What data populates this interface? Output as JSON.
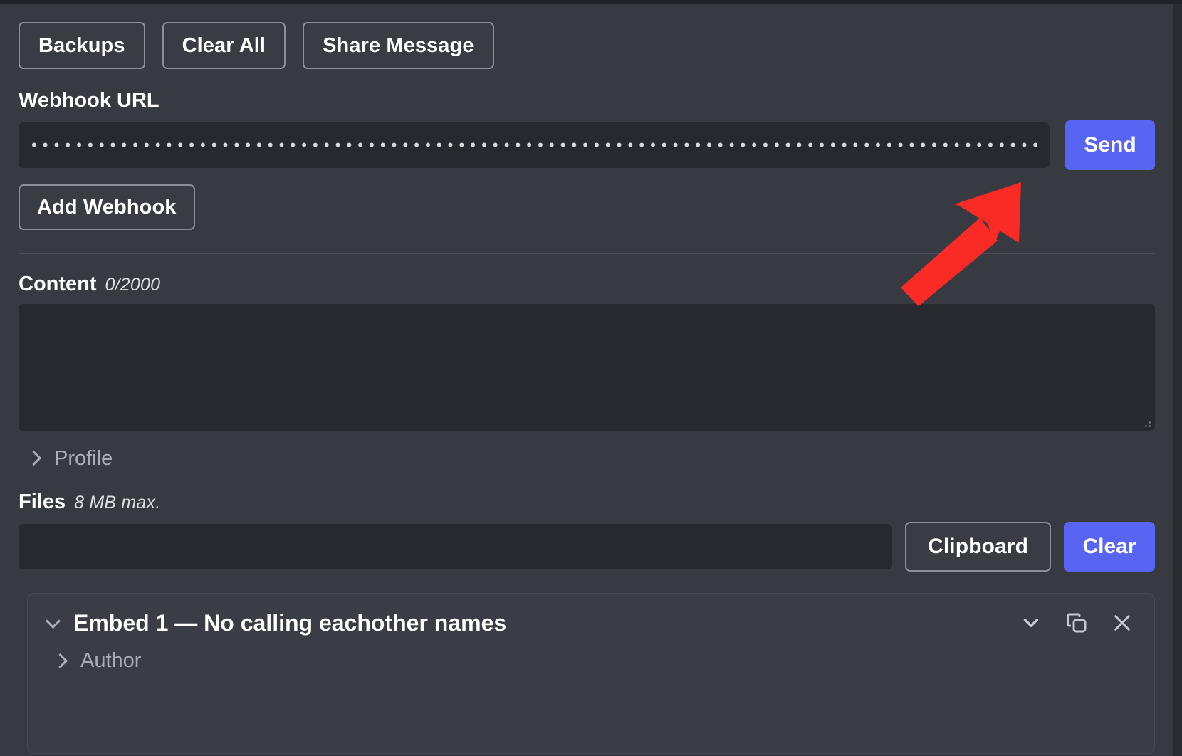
{
  "app": {
    "accent_color": "#5865f2",
    "background_color": "#36393f",
    "input_background": "#27292e",
    "annotation_arrow_color": "#fa2a25"
  },
  "toolbar": {
    "backups_label": "Backups",
    "clear_all_label": "Clear All",
    "share_message_label": "Share Message"
  },
  "webhook": {
    "label": "Webhook URL",
    "value_masked": "••••••••••••••••••••••••••••••••••••••••••••••••••••••••••••••••••••••••••••••••••••••••••••••••••••••••••••••••••••••••••••••••••••••••••",
    "placeholder": "",
    "send_label": "Send",
    "add_webhook_label": "Add Webhook"
  },
  "content": {
    "label": "Content",
    "counter": "0/2000",
    "value": "",
    "placeholder": ""
  },
  "profile": {
    "label": "Profile",
    "expanded": false,
    "chevron": "chevron-right-icon"
  },
  "files": {
    "label": "Files",
    "hint": "8 MB max.",
    "value": "",
    "clipboard_label": "Clipboard",
    "clear_label": "Clear"
  },
  "embed": {
    "title": "Embed 1 — No calling eachother names",
    "expanded": true,
    "collapse_chevron": "chevron-down-icon",
    "author_label": "Author",
    "author_expanded": false,
    "actions": [
      {
        "name": "move-down-icon",
        "title": "Move Down"
      },
      {
        "name": "duplicate-icon",
        "title": "Duplicate"
      },
      {
        "name": "close-icon",
        "title": "Remove"
      }
    ]
  }
}
